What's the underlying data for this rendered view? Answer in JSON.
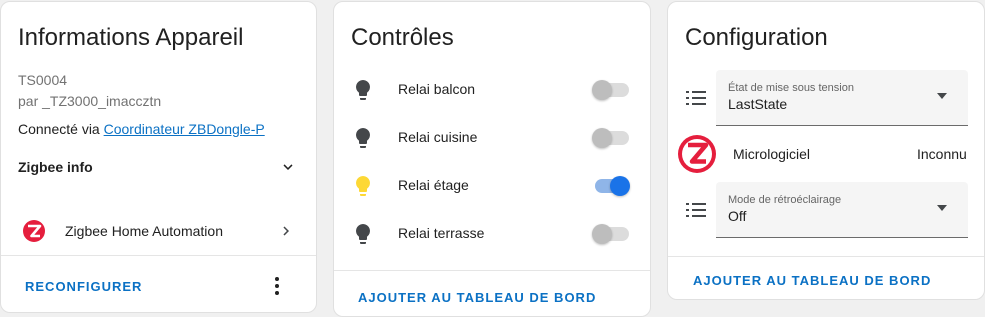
{
  "device_info": {
    "title": "Informations Appareil",
    "model": "TS0004",
    "vendor": "par _TZ3000_imaccztn",
    "connected_prefix": "Connecté via ",
    "connected_link": "Coordinateur ZBDongle-P",
    "zigbee_info_label": "Zigbee info",
    "integration_label": "Zigbee Home Automation",
    "reconfigure_label": "RECONFIGURER"
  },
  "controls": {
    "title": "Contrôles",
    "items": [
      {
        "label": "Relai balcon",
        "on": false,
        "icon": "lightbulb-icon"
      },
      {
        "label": "Relai cuisine",
        "on": false,
        "icon": "lightbulb-icon"
      },
      {
        "label": "Relai étage",
        "on": true,
        "icon": "lightbulb-icon"
      },
      {
        "label": "Relai terrasse",
        "on": false,
        "icon": "lightbulb-icon"
      }
    ],
    "add_label": "AJOUTER AU TABLEAU DE BORD"
  },
  "configuration": {
    "title": "Configuration",
    "power_on_state": {
      "caption": "État de mise sous tension",
      "value": "LastState"
    },
    "firmware": {
      "label": "Micrologiciel",
      "value": "Inconnu"
    },
    "backlight_mode": {
      "caption": "Mode de rétroéclairage",
      "value": "Off"
    },
    "add_label": "AJOUTER AU TABLEAU DE BORD"
  },
  "colors": {
    "accent": "#0b71c4",
    "toggle_on": "#1a73e8",
    "bulb_on": "#fdd835",
    "bulb_off": "#44474a",
    "zigbee_brand": "#e51e3d"
  }
}
